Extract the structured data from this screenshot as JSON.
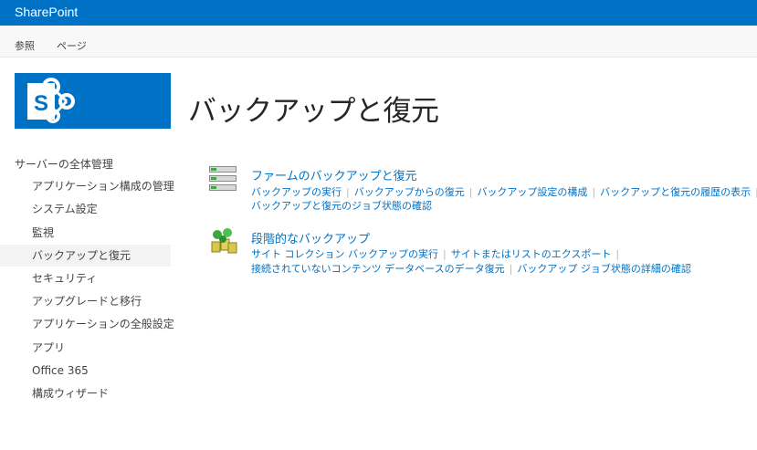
{
  "suitebar": {
    "brand": "SharePoint"
  },
  "ribbon": {
    "tabs": [
      "参照",
      "ページ"
    ]
  },
  "page": {
    "title": "バックアップと復元"
  },
  "quicklaunch": {
    "header": "サーバーの全体管理",
    "items": [
      "アプリケーション構成の管理",
      "システム設定",
      "監視",
      "バックアップと復元",
      "セキュリティ",
      "アップグレードと移行",
      "アプリケーションの全般設定",
      "アプリ",
      "Office 365",
      "構成ウィザード"
    ],
    "selected": "バックアップと復元"
  },
  "sections": [
    {
      "title": "ファームのバックアップと復元",
      "icon": "farm-backup-icon",
      "rows": [
        [
          "バックアップの実行",
          "バックアップからの復元",
          "バックアップ設定の構成",
          "バックアップと復元の履歴の表示"
        ],
        [
          "バックアップと復元のジョブ状態の確認"
        ]
      ]
    },
    {
      "title": "段階的なバックアップ",
      "icon": "granular-backup-icon",
      "rows": [
        [
          "サイト コレクション バックアップの実行",
          "サイトまたはリストのエクスポート"
        ],
        [
          "接続されていないコンテンツ データベースのデータ復元",
          "バックアップ ジョブ状態の詳細の確認"
        ]
      ]
    }
  ],
  "colors": {
    "accent": "#0072c6",
    "selected_bg": "#f3f3f3"
  }
}
